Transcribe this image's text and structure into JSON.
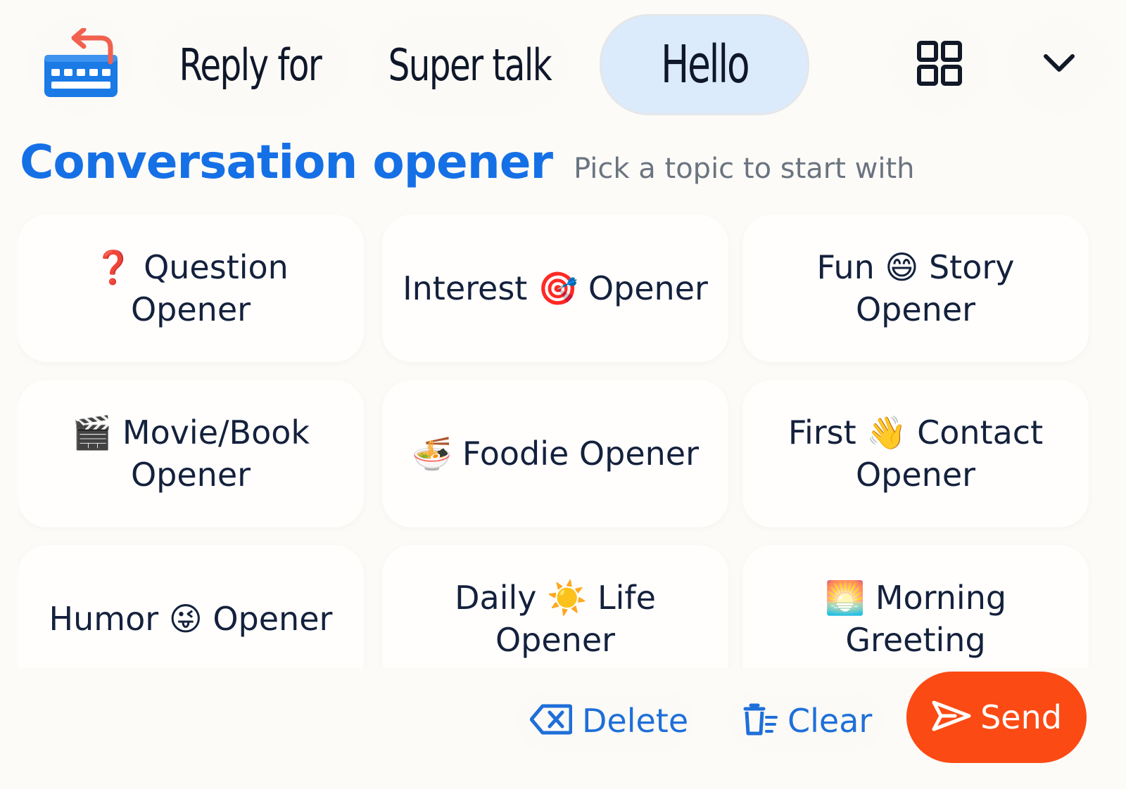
{
  "toolbar": {
    "tabs": [
      {
        "label": "Reply for",
        "icon": "reply-keyboard-icon"
      },
      {
        "label": "Super talk",
        "icon": "soundwave-icon"
      },
      {
        "label": "Hello",
        "selected": true
      }
    ],
    "grid_icon": "grid-icon",
    "collapse_icon": "chevron-down-icon",
    "selected_color": "#dcebfb"
  },
  "heading": {
    "title": "Conversation opener",
    "subtitle": "Pick a topic to start with"
  },
  "openers": [
    {
      "prefix": "❓ Question Opener",
      "rest": ""
    },
    {
      "prefix": "Interest 🎯 Opener",
      "rest": ""
    },
    {
      "prefix": "Fun 😄 Story",
      "rest": "Opener"
    },
    {
      "prefix": "🎬 Movie/Book",
      "rest": "Opener"
    },
    {
      "prefix": "🍜 Foodie Opener",
      "rest": ""
    },
    {
      "prefix": "First 👋 Contact",
      "rest": "Opener"
    },
    {
      "prefix": "Humor 😜 Opener",
      "rest": ""
    },
    {
      "prefix": "Daily ☀️ Life",
      "rest": "Opener"
    },
    {
      "prefix": "🌅 Morning",
      "rest": "Greeting"
    }
  ],
  "actions": {
    "delete_label": "Delete",
    "clear_label": "Clear",
    "send_label": "Send",
    "accent_color": "#1f6fd9",
    "send_color": "#fc4a14"
  }
}
